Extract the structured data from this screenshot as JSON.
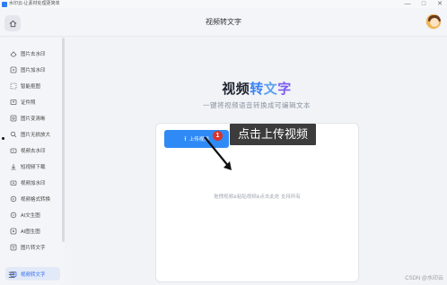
{
  "window": {
    "title": "水印云-让素材处理更简单",
    "controls": [
      "—",
      "□",
      "✕"
    ]
  },
  "header": {
    "title": "视频转文字"
  },
  "sidebar": {
    "items": [
      {
        "label": "图片去水印",
        "icon": "eraser-icon"
      },
      {
        "label": "图片加水印",
        "icon": "stamp-icon"
      },
      {
        "label": "智能抠图",
        "icon": "cutout-icon"
      },
      {
        "label": "证件照",
        "icon": "id-photo-icon"
      },
      {
        "label": "图片变清晰",
        "icon": "clarity-icon"
      },
      {
        "label": "图片无损放大",
        "icon": "zoom-icon"
      },
      {
        "label": "视频去水印",
        "icon": "video-eraser-icon"
      },
      {
        "label": "短视频下载",
        "icon": "download-icon"
      },
      {
        "label": "视频加水印",
        "icon": "video-stamp-icon"
      },
      {
        "label": "视频格式转换",
        "icon": "convert-icon"
      },
      {
        "label": "AI文生图",
        "icon": "ai-text-image-icon"
      },
      {
        "label": "AI图生图",
        "icon": "ai-image-image-icon"
      },
      {
        "label": "图片转文字",
        "icon": "image-text-icon"
      },
      {
        "label": "视频转文字",
        "icon": "video-text-icon",
        "active": true
      }
    ]
  },
  "main": {
    "hero": {
      "part1": "视频",
      "part2": "转",
      "part3": "文",
      "part4": "字"
    },
    "subtitle": "一键将视频语音转换成可编辑文本",
    "upload_button": "上传视频",
    "hint": "拖拽视频&粘贴视频&点击此处 支持所有",
    "callout": "点击上传视频",
    "step_number": "1"
  },
  "footer": {
    "watermark": "CSDN @水印云"
  },
  "colors": {
    "accent": "#2f8af5",
    "active_nav_bg": "#e2e9f7",
    "badge": "#d9342b",
    "callout_bg": "#3c3c3c"
  }
}
